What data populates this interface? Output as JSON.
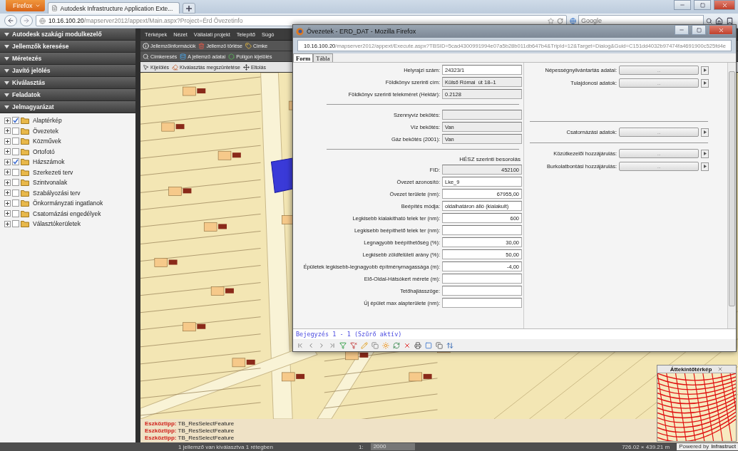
{
  "browser": {
    "menu_button": "Firefox",
    "tab_title": "Autodesk Infrastructure Application Exte...",
    "url": {
      "host": "10.16.100.20",
      "path": "/mapserver2012/appext/Main.aspx?Project=Érd Övezetinfo"
    },
    "search_placeholder": "Google"
  },
  "sidebar": {
    "sections": [
      "Autodesk szakági modulkezelő",
      "Jellemzők keresése",
      "Méretezés",
      "Javító jelölés",
      "Kiválasztás",
      "Feladatok",
      "Jelmagyarázat"
    ],
    "layers": [
      {
        "label": "Alaptérkép",
        "checked": true,
        "expanded": false
      },
      {
        "label": "Övezetek",
        "checked": false,
        "expanded": false
      },
      {
        "label": "Közművek",
        "checked": false,
        "expanded": false
      },
      {
        "label": "Ortofotó",
        "checked": false,
        "expanded": false
      },
      {
        "label": "Házszámok",
        "checked": true,
        "expanded": false
      },
      {
        "label": "Szerkezeti terv",
        "checked": false,
        "expanded": false
      },
      {
        "label": "Szintvonalak",
        "checked": false,
        "expanded": false
      },
      {
        "label": "Szabályozási terv",
        "checked": false,
        "expanded": false
      },
      {
        "label": "Önkormányzati ingatlanok",
        "checked": false,
        "expanded": false
      },
      {
        "label": "Csatornázási engedélyek",
        "checked": false,
        "expanded": false
      },
      {
        "label": "Választókerületek",
        "checked": false,
        "expanded": false
      }
    ]
  },
  "menu": [
    "Térképek",
    "Nézet",
    "Vállalati projekt",
    "Telepítő",
    "Súgó"
  ],
  "toolbar_rows": [
    [
      "Jellemzőinformációk",
      "Jellemző törlése",
      "Címke"
    ],
    [
      "Címkeresés",
      "A jellemző adatai",
      "Poligon kijelölés"
    ],
    [
      "Kijelölés",
      "Kiválasztás megszüntetése",
      "Eltolás"
    ]
  ],
  "messages": [
    {
      "label": "Eszköztipp:",
      "value": "TB_ResSelectFeature"
    },
    {
      "label": "Eszköztipp:",
      "value": "TB_ResSelectFeature"
    },
    {
      "label": "Eszköztipp:",
      "value": "TB_ResSelectFeature"
    }
  ],
  "status_bar": {
    "selection": "1 jellemző van kiválasztva 1 rétegben",
    "scale_label": "1:",
    "scale": "2000",
    "extent": "726.02 × 439.21 m",
    "powered_by": "Powered by",
    "logo": "Infrastruct"
  },
  "overview": {
    "title": "Áttekintőtérkép"
  },
  "dialog": {
    "title": "Övezetek - ERD_DAT - Mozilla Firefox",
    "url": {
      "host": "10.16.100.20",
      "path": "/mapserver2012/appext/Execute.aspx?TBSID=5cad4300991994e07a5b28b011db647b4&TripId=12&Target=Dialog&Guid=C151dd4032b97474fa4691900c525fd4e"
    },
    "tabs": [
      {
        "label": "Form",
        "selected": true
      },
      {
        "label": "Tábla",
        "selected": false
      }
    ],
    "form_left": [
      {
        "fields": [
          {
            "label": "Helyrajzi szám:",
            "value": "24323/1",
            "kind": "text",
            "readonly": false
          },
          {
            "label": "Földkönyv szerinti cím:",
            "value": "Külső Római  út 18–1",
            "kind": "text",
            "readonly": true
          },
          {
            "label": "Földkönyv szerinti telekméret (Hektár):",
            "value": "0.2128",
            "kind": "text",
            "readonly": true
          }
        ]
      },
      {
        "fields": [
          {
            "label": "Szennyvíz bekötés:",
            "kind": "text",
            "readonly": true
          },
          {
            "label": "Víz bekötés:",
            "value": "Van",
            "kind": "text",
            "readonly": true
          },
          {
            "label": "Gáz bekötés (2001):",
            "value": "Van",
            "kind": "text",
            "readonly": true
          }
        ]
      },
      {
        "heading": "HÉSZ szerinti besorolás",
        "fields": [
          {
            "label": "FID:",
            "value": "452100",
            "kind": "number",
            "readonly": true
          },
          {
            "label": "Övezet azonosító:",
            "value": "Lke_9",
            "kind": "text",
            "readonly": false
          },
          {
            "label": "Övezet területe (nm):",
            "value": "67955,00",
            "kind": "number",
            "readonly": false
          },
          {
            "label": "Beépítés módja:",
            "value": "oldalhatáron álló (kialakult)",
            "kind": "text",
            "readonly": false
          },
          {
            "label": "Legkisebb kialakítható telek ter (nm):",
            "value": "600",
            "kind": "number",
            "readonly": false
          },
          {
            "label": "Legkisebb beépíthető telek ter (nm):",
            "kind": "number",
            "readonly": false
          },
          {
            "label": "Legnagyobb beépíthetőség (%):",
            "value": "30,00",
            "kind": "number",
            "readonly": false
          },
          {
            "label": "Legkisebb zöldfelületi arány (%):",
            "value": "50,00",
            "kind": "number",
            "readonly": false
          },
          {
            "label": "Épületek legkisebb-legnagyobb építménymagassága (m):",
            "value": "-4,00",
            "kind": "number",
            "readonly": false
          },
          {
            "label": "Elő-Oldal-Hátsókert mérete (m):",
            "kind": "text",
            "readonly": false
          },
          {
            "label": "Tetőhajlásszöge:",
            "kind": "text",
            "readonly": false
          },
          {
            "label": "Új épület max alapterülete (nm):",
            "kind": "number",
            "readonly": false
          }
        ]
      }
    ],
    "form_right": [
      {
        "items": [
          {
            "label": "Népességnyilvántartás adatai:",
            "button": "..."
          },
          {
            "label": "Tulajdonosi adatok:",
            "button": "..."
          }
        ]
      },
      {
        "items": [
          {
            "label": "Csatornázási adatok:",
            "button": "..."
          }
        ]
      },
      {
        "items": [
          {
            "label": "Közútkezelői hozzájárulás:",
            "button": "..."
          },
          {
            "label": "Burkolatbontási hozzájárulás:",
            "button": "..."
          }
        ]
      }
    ],
    "record_status": "Bejegyzés 1 - 1 (Szűrő aktív)"
  }
}
